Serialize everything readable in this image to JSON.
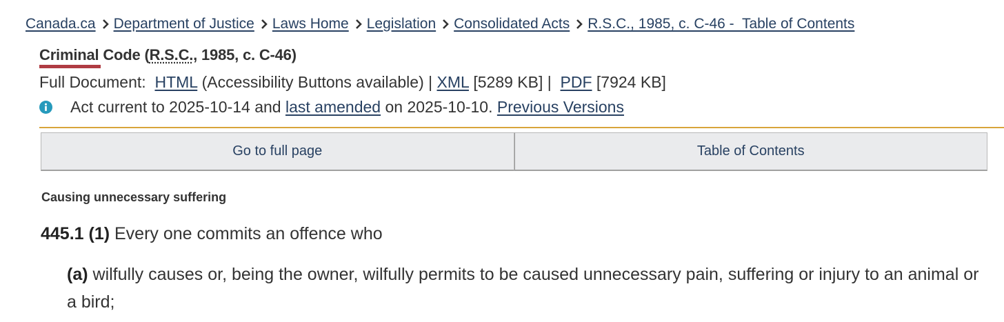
{
  "breadcrumb": {
    "items": [
      "Canada.ca",
      "Department of Justice",
      "Laws Home",
      "Legislation",
      "Consolidated Acts",
      "R.S.C., 1985, c. C-46 -  Table of Contents"
    ]
  },
  "title": {
    "prefix": "Criminal Code (",
    "abbr": "R.S.C.",
    "suffix": ", 1985, c. C-46)"
  },
  "full_document": {
    "label": "Full Document:  ",
    "html_link": "HTML",
    "html_note": " (Accessibility Buttons available) | ",
    "xml_link": "XML",
    "xml_size": " [5289 KB] |  ",
    "pdf_link": "PDF",
    "pdf_size": " [7924 KB]"
  },
  "info": {
    "icon": "info-icon",
    "text_before": "Act current to 2025-10-14 and ",
    "amended_link": "last amended",
    "text_after": " on 2025-10-10. ",
    "versions_link": "Previous Versions"
  },
  "buttons": {
    "full_page": "Go to full page",
    "toc": "Table of Contents"
  },
  "content": {
    "marginal_note": "Causing unnecessary suffering",
    "section_number": "445.1 (1)",
    "section_text": " Every one commits an offence who",
    "para_label": "(a)",
    "para_text": " wilfully causes or, being the owner, wilfully permits to be caused unnecessary pain, suffering or injury to an animal or a bird;"
  },
  "colors": {
    "link": "#284162",
    "accent_red": "#af3c43",
    "gold_rule": "#d8a43a",
    "info_blue": "#269abc"
  }
}
